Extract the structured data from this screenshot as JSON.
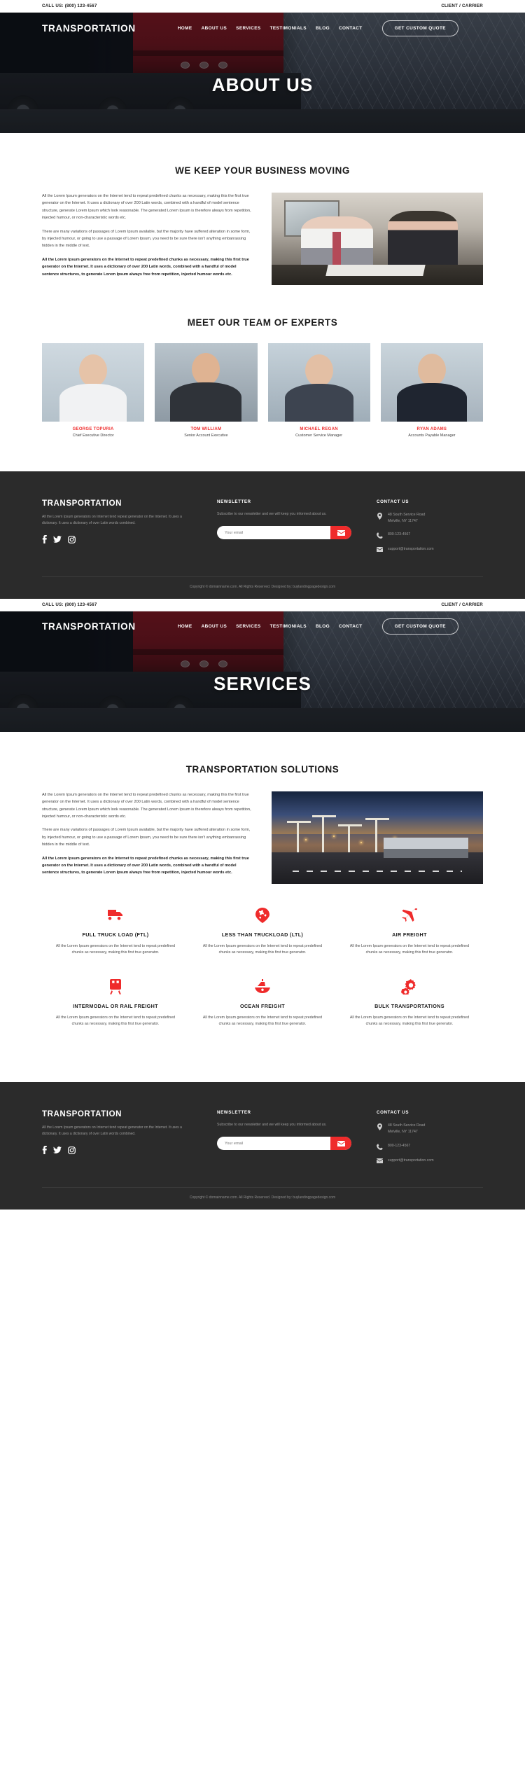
{
  "brand": {
    "name": "TRANSPORTATION",
    "accent": "#ef2b2b",
    "dark": "#2b2b2b"
  },
  "topbar": {
    "phone": "CALL US: (800) 123-4567",
    "portal": "CLIENT / CARRIER"
  },
  "nav": {
    "links": [
      {
        "label": "HOME"
      },
      {
        "label": "ABOUT US"
      },
      {
        "label": "SERVICES"
      },
      {
        "label": "TESTIMONIALS"
      },
      {
        "label": "BLOG"
      },
      {
        "label": "CONTACT"
      }
    ],
    "cta": "GET CUSTOM QUOTE"
  },
  "page_about": {
    "hero_title": "ABOUT US",
    "section_title": "WE KEEP YOUR BUSINESS MOVING",
    "paragraphs": [
      "All the Lorem Ipsum generators on the Internet tend to repeat predefined chunks as necessary, making this the first true generator on the Internet. It uses a dictionary of over 200 Latin words, combined with a handful of model sentence structure, generate Lorem Ipsum which look reasonable. The generated Lorem Ipsum is therefore always from repetition, injected humour, or non-characteristic words etc.",
      "There are many variations of passages of Lorem Ipsum available, but the majority have suffered alteration in some form, by injected humour, or going to use a passage of Lorem Ipsum, you need to be sure there isn't anything embarrassing hidden in the middle of text."
    ],
    "paragraph_bold": "All the Lorem Ipsum generators on the Internet to repeat predefined chunks as necessary, making this first true generator on the Internet. It uses a dictionary of over 200 Latin words, combined with a handful of model sentence structures, to generate Lorem Ipsum always free from repetition, injected humour words etc.",
    "team_title": "MEET OUR TEAM OF EXPERTS",
    "team": [
      {
        "name": "GEORGE TOPURIA",
        "role": "Chief Executive Director"
      },
      {
        "name": "TOM WILLIAM",
        "role": "Senior Account Executive"
      },
      {
        "name": "MICHAEL REGAN",
        "role": "Customer Service Manager"
      },
      {
        "name": "RYAN ADAMS",
        "role": "Accounts Payable Manager"
      }
    ]
  },
  "page_services": {
    "hero_title": "SERVICES",
    "section_title": "TRANSPORTATION SOLUTIONS",
    "paragraphs": [
      "All the Lorem Ipsum generators on the Internet tend to repeat predefined chunks as necessary, making this the first true generator on the Internet. It uses a dictionary of over 200 Latin words, combined with a handful of model sentence structure, generate Lorem Ipsum which look reasonable. The generated Lorem Ipsum is therefore always from repetition, injected humour, or non-characteristic words etc.",
      "There are many variations of passages of Lorem Ipsum available, but the majority have suffered alteration in some form, by injected humour, or going to use a passage of Lorem Ipsum, you need to be sure there isn't anything embarrassing hidden in the middle of text."
    ],
    "paragraph_bold": "All the Lorem Ipsum generators on the Internet to repeat predefined chunks as necessary, making this first true generator on the Internet. It uses a dictionary of over 200 Latin words, combined with a handful of model sentence structures, to generate Lorem Ipsum always free from repetition, injected humour words etc.",
    "services": [
      {
        "icon": "truck-icon",
        "title": "FULL TRUCK LOAD (FTL)",
        "desc": "All the Lorem Ipsum generators on the Internet tend to repeat predefined chunks as necessary, making this first true generator."
      },
      {
        "icon": "globe-icon",
        "title": "LESS THAN TRUCKLOAD (LTL)",
        "desc": "All the Lorem Ipsum generators on the Internet tend to repeat predefined chunks as necessary, making this first true generator."
      },
      {
        "icon": "plane-icon",
        "title": "AIR FREIGHT",
        "desc": "All the Lorem Ipsum generators on the Internet tend to repeat predefined chunks as necessary, making this first true generator."
      },
      {
        "icon": "train-icon",
        "title": "INTERMODAL OR RAIL FREIGHT",
        "desc": "All the Lorem Ipsum generators on the Internet tend to repeat predefined chunks as necessary, making this first true generator."
      },
      {
        "icon": "ship-icon",
        "title": "OCEAN FREIGHT",
        "desc": "All the Lorem Ipsum generators on the Internet tend to repeat predefined chunks as necessary, making this first true generator."
      },
      {
        "icon": "gears-icon",
        "title": "BULK TRANSPORTATIONS",
        "desc": "All the Lorem Ipsum generators on the Internet tend to repeat predefined chunks as necessary, making this first true generator."
      }
    ]
  },
  "footer": {
    "logo": "TRANSPORTATION",
    "about": "All the Lorem Ipsum generators on Internet tend repeat generator on the Internet. It uses a dictionary. It uses a dictionary of over Latin words combined.",
    "socials": [
      {
        "name": "facebook-icon"
      },
      {
        "name": "twitter-icon"
      },
      {
        "name": "instagram-icon"
      }
    ],
    "newsletter": {
      "title": "NEWSLETTER",
      "text": "Subscribe to our newsletter and we will keep you informed about us.",
      "placeholder": "Your email",
      "button": "envelope-icon"
    },
    "contact": {
      "title": "CONTACT US",
      "address_line1": "48 South Service Road",
      "address_line2": "Melville, NY 11747",
      "phone": "800-123-4567",
      "email": "support@transportation.com"
    },
    "copyright": "Copyright © domainname.com. All Rights Reserved. Designed by: buylandingpagedesign.com"
  }
}
